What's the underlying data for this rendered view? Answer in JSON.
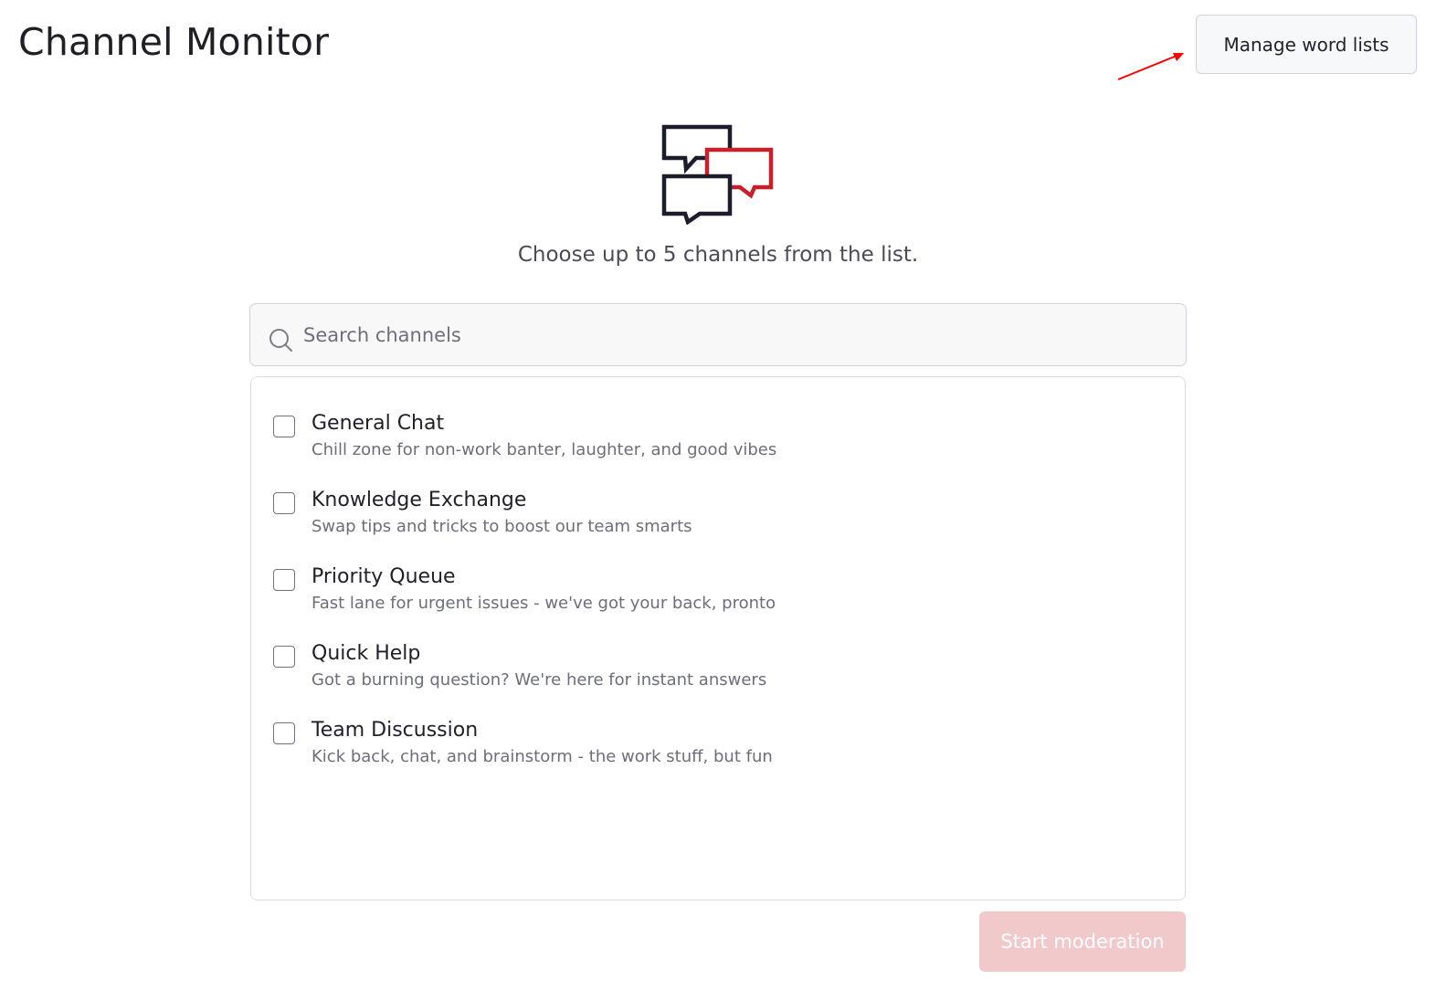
{
  "header": {
    "title": "Channel Monitor",
    "manage_word_lists_label": "Manage word lists"
  },
  "hero": {
    "icon": "chat-bubbles-icon",
    "instruction": "Choose up to 5 channels from the list."
  },
  "search": {
    "placeholder": "Search channels",
    "value": "",
    "icon": "search-icon"
  },
  "channels": [
    {
      "name": "General Chat",
      "description": "Chill zone for non-work banter, laughter, and good vibes",
      "checked": false
    },
    {
      "name": "Knowledge Exchange",
      "description": "Swap tips and tricks to boost our team smarts",
      "checked": false
    },
    {
      "name": "Priority Queue",
      "description": "Fast lane for urgent issues - we've got your back, pronto",
      "checked": false
    },
    {
      "name": "Quick Help",
      "description": "Got a burning question? We're here for instant answers",
      "checked": false
    },
    {
      "name": "Team Discussion",
      "description": "Kick back, chat, and brainstorm - the work stuff, but fun",
      "checked": false
    }
  ],
  "footer": {
    "start_label": "Start moderation",
    "start_enabled": false
  },
  "colors": {
    "accent_red": "#c8202b",
    "icon_dark": "#1b1d2c",
    "start_disabled_bg": "#f2c9cb",
    "annotation_arrow": "#ff0000"
  }
}
